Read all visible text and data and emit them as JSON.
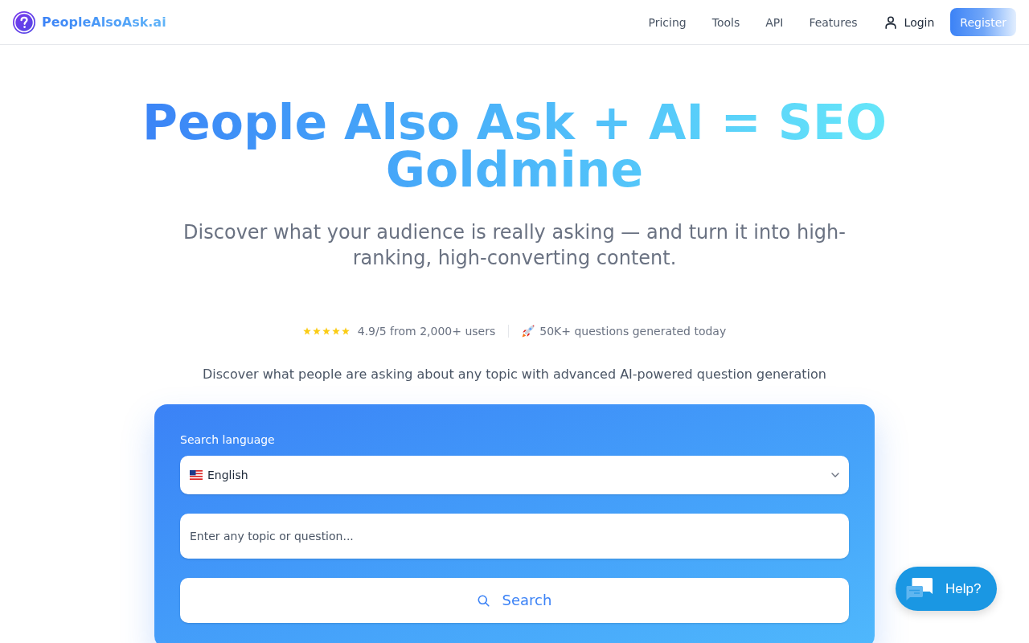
{
  "header": {
    "logo": {
      "text": "PeopleAlsoAsk.ai"
    },
    "nav": [
      {
        "label": "Pricing"
      },
      {
        "label": "Tools"
      },
      {
        "label": "API"
      },
      {
        "label": "Features"
      }
    ],
    "login": {
      "label": "Login"
    },
    "register": {
      "label": "Register"
    }
  },
  "hero": {
    "title": "People Also Ask + AI = SEO Goldmine",
    "subtitle": "Discover what your audience is really asking — and turn it into high-ranking, high-converting content."
  },
  "stats": {
    "rating": {
      "stars": 5,
      "text": "4.9/5 from 2,000+ users"
    },
    "activity": {
      "text": "50K+ questions generated today"
    }
  },
  "description": "Discover what people are asking about any topic with advanced AI-powered question generation",
  "search_card": {
    "language_label": "Search language",
    "language": {
      "value": "English"
    },
    "topic": {
      "placeholder": "Enter any topic or question..."
    },
    "search_button": {
      "label": "Search"
    }
  },
  "help_button": {
    "label": "Help?"
  }
}
